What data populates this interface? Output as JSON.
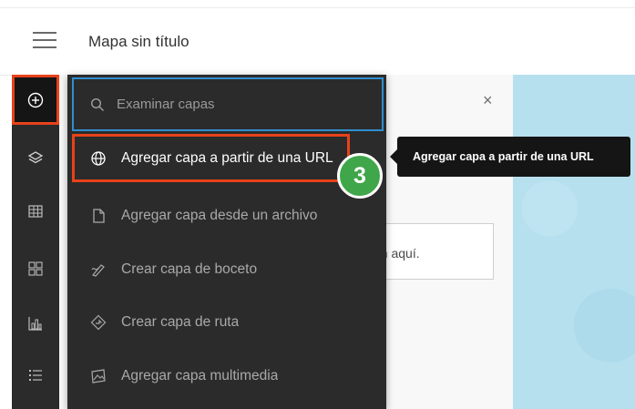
{
  "header": {
    "title": "Mapa sin título"
  },
  "panel": {
    "close_symbol": "×",
    "hint": "án aquí."
  },
  "search": {
    "placeholder": "Examinar capas"
  },
  "menu": {
    "items": [
      {
        "label": "Agregar capa a partir de una URL",
        "icon": "globe-icon",
        "selected": true
      },
      {
        "label": "Agregar capa desde un archivo",
        "icon": "file-icon",
        "selected": false
      },
      {
        "label": "Crear capa de boceto",
        "icon": "sketch-icon",
        "selected": false
      },
      {
        "label": "Crear capa de ruta",
        "icon": "route-icon",
        "selected": false
      },
      {
        "label": "Agregar capa multimedia",
        "icon": "media-icon",
        "selected": false
      }
    ]
  },
  "tooltip": {
    "text": "Agregar capa a partir de una URL"
  },
  "step_badge": {
    "number": "3"
  },
  "rail": {
    "items": [
      "add-icon",
      "layers-icon",
      "table-icon",
      "widgets-icon",
      "chart-icon",
      "legend-icon"
    ]
  },
  "colors": {
    "highlight": "#e8421a",
    "focus": "#2f8ecf",
    "step_badge": "#3fa64a",
    "dark_panel": "#2b2b2b"
  }
}
